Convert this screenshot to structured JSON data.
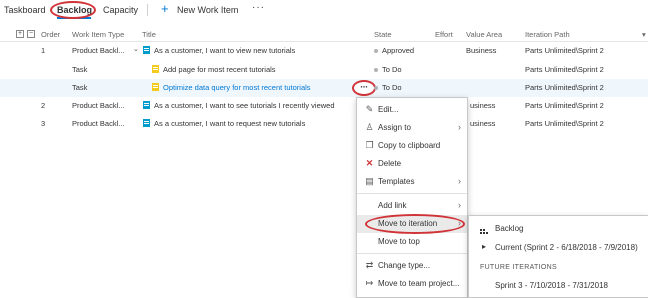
{
  "nav": {
    "tabs": [
      "Taskboard",
      "Backlog",
      "Capacity"
    ],
    "active_tab": "Backlog",
    "new_item_label": "New Work Item",
    "more_label": "···"
  },
  "table": {
    "expand_all": "+",
    "collapse_all": "−",
    "headers": {
      "order": "Order",
      "type": "Work Item Type",
      "title": "Title",
      "state": "State",
      "effort": "Effort",
      "value_area": "Value Area",
      "iteration": "Iteration Path"
    },
    "rows": [
      {
        "order": "1",
        "type": "Product Backl...",
        "title": "As a customer, I want to view new tutorials",
        "state": "Approved",
        "value_area": "Business",
        "iteration": "Parts Unlimited\\Sprint 2"
      },
      {
        "order": "",
        "type": "Task",
        "title": "Add page for most recent tutorials",
        "state": "To Do",
        "value_area": "",
        "iteration": "Parts Unlimited\\Sprint 2"
      },
      {
        "order": "",
        "type": "Task",
        "title": "Optimize data query for most recent tutorials",
        "state": "To Do",
        "value_area": "",
        "iteration": "Parts Unlimited\\Sprint 2"
      },
      {
        "order": "2",
        "type": "Product Backl...",
        "title": "As a customer, I want to see tutorials I recently viewed",
        "state": "",
        "value_area": "usiness",
        "iteration": "Parts Unlimited\\Sprint 2"
      },
      {
        "order": "3",
        "type": "Product Backl...",
        "title": "As a customer, I want to request new tutorials",
        "state": "",
        "value_area": "usiness",
        "iteration": "Parts Unlimited\\Sprint 2"
      }
    ],
    "row_more_label": "···"
  },
  "context_menu": {
    "items": [
      {
        "label": "Edit...",
        "icon": "pencil-icon"
      },
      {
        "label": "Assign to",
        "icon": "assign-user-icon"
      },
      {
        "label": "Copy to clipboard",
        "icon": "copy-icon"
      },
      {
        "label": "Delete",
        "icon": "delete-x-icon"
      },
      {
        "label": "Templates",
        "icon": "template-icon"
      },
      {
        "label": "Add link",
        "icon": ""
      },
      {
        "label": "Move to iteration",
        "icon": ""
      },
      {
        "label": "Move to top",
        "icon": ""
      },
      {
        "label": "Change type...",
        "icon": "change-type-icon"
      },
      {
        "label": "Move to team project...",
        "icon": "move-project-icon"
      }
    ]
  },
  "submenu": {
    "backlog_label": "Backlog",
    "current_label": "Current (Sprint 2 - 6/18/2018 - 7/9/2018)",
    "future_header": "FUTURE ITERATIONS",
    "sprint3_label": "Sprint 3 - 7/10/2018 - 7/31/2018"
  },
  "colors": {
    "accent": "#0078d4",
    "highlight_circle": "#d13438",
    "pbi_icon": "#009ccc",
    "task_icon": "#f2cb1d"
  }
}
